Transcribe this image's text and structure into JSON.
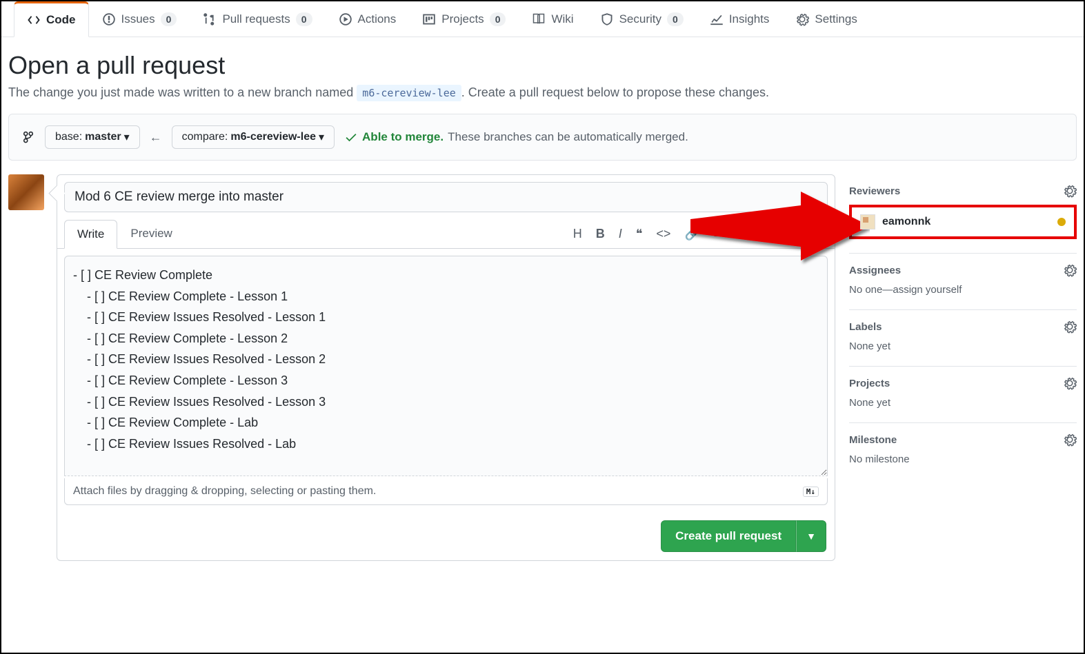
{
  "tabs": [
    {
      "icon": "code",
      "label": "Code",
      "count": null,
      "active": true
    },
    {
      "icon": "issue",
      "label": "Issues",
      "count": "0"
    },
    {
      "icon": "pr",
      "label": "Pull requests",
      "count": "0"
    },
    {
      "icon": "play",
      "label": "Actions",
      "count": null
    },
    {
      "icon": "project",
      "label": "Projects",
      "count": "0"
    },
    {
      "icon": "wiki",
      "label": "Wiki",
      "count": null
    },
    {
      "icon": "shield",
      "label": "Security",
      "count": "0"
    },
    {
      "icon": "graph",
      "label": "Insights",
      "count": null
    },
    {
      "icon": "gear",
      "label": "Settings",
      "count": null
    }
  ],
  "heading": "Open a pull request",
  "subtext_a": "The change you just made was written to a new branch named ",
  "subtext_branch": "m6-cereview-lee",
  "subtext_b": ". Create a pull request below to propose these changes.",
  "base_prefix": "base: ",
  "base_branch": "master",
  "compare_prefix": "compare: ",
  "compare_branch": "m6-cereview-lee",
  "merge_ok": "Able to merge.",
  "merge_info": "These branches can be automatically merged.",
  "pr_title": "Mod 6 CE review merge into master",
  "editor_tabs": {
    "write": "Write",
    "preview": "Preview"
  },
  "body": "- [ ] CE Review Complete\n    - [ ] CE Review Complete - Lesson 1\n    - [ ] CE Review Issues Resolved - Lesson 1\n    - [ ] CE Review Complete - Lesson 2\n    - [ ] CE Review Issues Resolved - Lesson 2\n    - [ ] CE Review Complete - Lesson 3\n    - [ ] CE Review Issues Resolved - Lesson 3\n    - [ ] CE Review Complete - Lab\n    - [ ] CE Review Issues Resolved - Lab",
  "attach_hint": "Attach files by dragging & dropping, selecting or pasting them.",
  "md_badge": "M↓",
  "submit_label": "Create pull request",
  "sidebar": {
    "reviewers": {
      "title": "Reviewers",
      "user": "eamonnk"
    },
    "assignees": {
      "title": "Assignees",
      "body": "No one—assign yourself"
    },
    "labels": {
      "title": "Labels",
      "body": "None yet"
    },
    "projects": {
      "title": "Projects",
      "body": "None yet"
    },
    "milestone": {
      "title": "Milestone",
      "body": "No milestone"
    }
  }
}
